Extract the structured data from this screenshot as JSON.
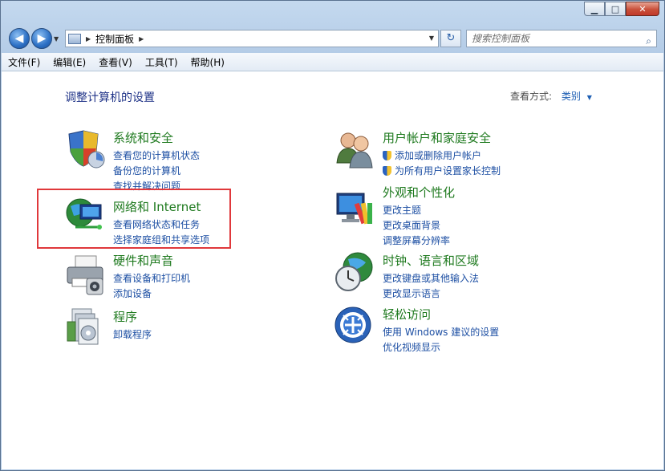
{
  "window": {
    "minimize": "▁",
    "maximize": "□",
    "close": "✕"
  },
  "address": {
    "path": "控制面板"
  },
  "search": {
    "placeholder": "搜索控制面板"
  },
  "menu": [
    "文件(F)",
    "编辑(E)",
    "查看(V)",
    "工具(T)",
    "帮助(H)"
  ],
  "content": {
    "heading": "调整计算机的设置",
    "view_by_label": "查看方式:",
    "view_by_value": "类别"
  },
  "categories": [
    {
      "title": "系统和安全",
      "links": [
        "查看您的计算机状态",
        "备份您的计算机",
        "查找并解决问题"
      ],
      "icon": "shield-icon"
    },
    {
      "title": "网络和 Internet",
      "links": [
        "查看网络状态和任务",
        "选择家庭组和共享选项"
      ],
      "icon": "network-globe-icon"
    },
    {
      "title": "硬件和声音",
      "links": [
        "查看设备和打印机",
        "添加设备"
      ],
      "icon": "printer-icon"
    },
    {
      "title": "程序",
      "links": [
        "卸载程序"
      ],
      "icon": "programs-icon"
    },
    {
      "title": "用户帐户和家庭安全",
      "links": [
        "添加或删除用户帐户",
        "为所有用户设置家长控制"
      ],
      "icon": "users-icon"
    },
    {
      "title": "外观和个性化",
      "links": [
        "更改主题",
        "更改桌面背景",
        "调整屏幕分辨率"
      ],
      "icon": "monitor-palette-icon"
    },
    {
      "title": "时钟、语言和区域",
      "links": [
        "更改键盘或其他输入法",
        "更改显示语言"
      ],
      "icon": "clock-globe-icon"
    },
    {
      "title": "轻松访问",
      "links": [
        "使用 Windows 建议的设置",
        "优化视频显示"
      ],
      "icon": "ease-of-access-icon"
    }
  ],
  "colors": {
    "category_title": "#1f7a1f",
    "link": "#1d4fa3",
    "highlight": "#e0383b"
  }
}
